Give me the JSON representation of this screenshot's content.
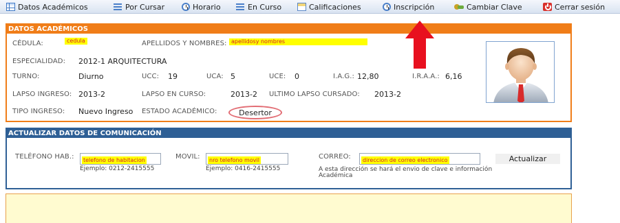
{
  "nav": {
    "items": [
      {
        "label": "Datos Académicos",
        "icon": "table-icon"
      },
      {
        "label": "Por Cursar",
        "icon": "list-icon"
      },
      {
        "label": "Horario",
        "icon": "clock-icon"
      },
      {
        "label": "En Curso",
        "icon": "list-icon"
      },
      {
        "label": "Calificaciones",
        "icon": "sheet-icon"
      },
      {
        "label": "Inscripción",
        "icon": "clock-icon"
      },
      {
        "label": "Cambiar Clave",
        "icon": "key-icon"
      },
      {
        "label": "Cerrar sesión",
        "icon": "power-icon"
      }
    ]
  },
  "datos": {
    "header": "DATOS ACADÉMICOS",
    "cedula_label": "CÉDULA:",
    "cedula_value": "cedula",
    "apellidos_label": "APELLIDOS Y NOMBRES:",
    "apellidos_value": "apellidosy nombres",
    "especialidad_label": "ESPECIALIDAD:",
    "especialidad_value": "2012-1 ARQUITECTURA",
    "turno_label": "TURNO:",
    "turno_value": "Diurno",
    "ucc_label": "UCC:",
    "ucc_value": "19",
    "uca_label": "UCA:",
    "uca_value": "5",
    "uce_label": "UCE:",
    "uce_value": "0",
    "iag_label": "I.A.G.:",
    "iag_value": "12,80",
    "iraa_label": "I.R.A.A.:",
    "iraa_value": "6,16",
    "lapso_ingreso_label": "LAPSO INGRESO:",
    "lapso_ingreso_value": "2013-2",
    "lapso_curso_label": "LAPSO EN CURSO:",
    "lapso_curso_value": "2013-2",
    "ultimo_lapso_label": "ULTIMO LAPSO CURSADO:",
    "ultimo_lapso_value": "2013-2",
    "tipo_ingreso_label": "TIPO INGRESO:",
    "tipo_ingreso_value": "Nuevo Ingreso",
    "estado_label": "ESTADO ACADÉMICO:",
    "estado_value": "Desertor"
  },
  "comunicacion": {
    "header": "ACTUALIZAR DATOS DE COMUNICACIÓN",
    "telefono_label": "TELÉFONO HAB.:",
    "telefono_value": "telefono de habitacion",
    "telefono_hint": "Ejemplo: 0212-2415555",
    "movil_label": "MOVIL:",
    "movil_value": "nro telefono movil",
    "movil_hint": "Ejemplo: 0416-2415555",
    "correo_label": "CORREO:",
    "correo_value": "direccion de correo electronico",
    "correo_hint_1": "A esta dirección se hará el envio de clave e información",
    "correo_hint_2": "Académica",
    "actualizar_label": "Actualizar"
  },
  "colors": {
    "accent_orange": "#f07d18",
    "accent_blue": "#2e5f95",
    "highlight": "#ffff00",
    "arrow_red": "#e8101f"
  }
}
